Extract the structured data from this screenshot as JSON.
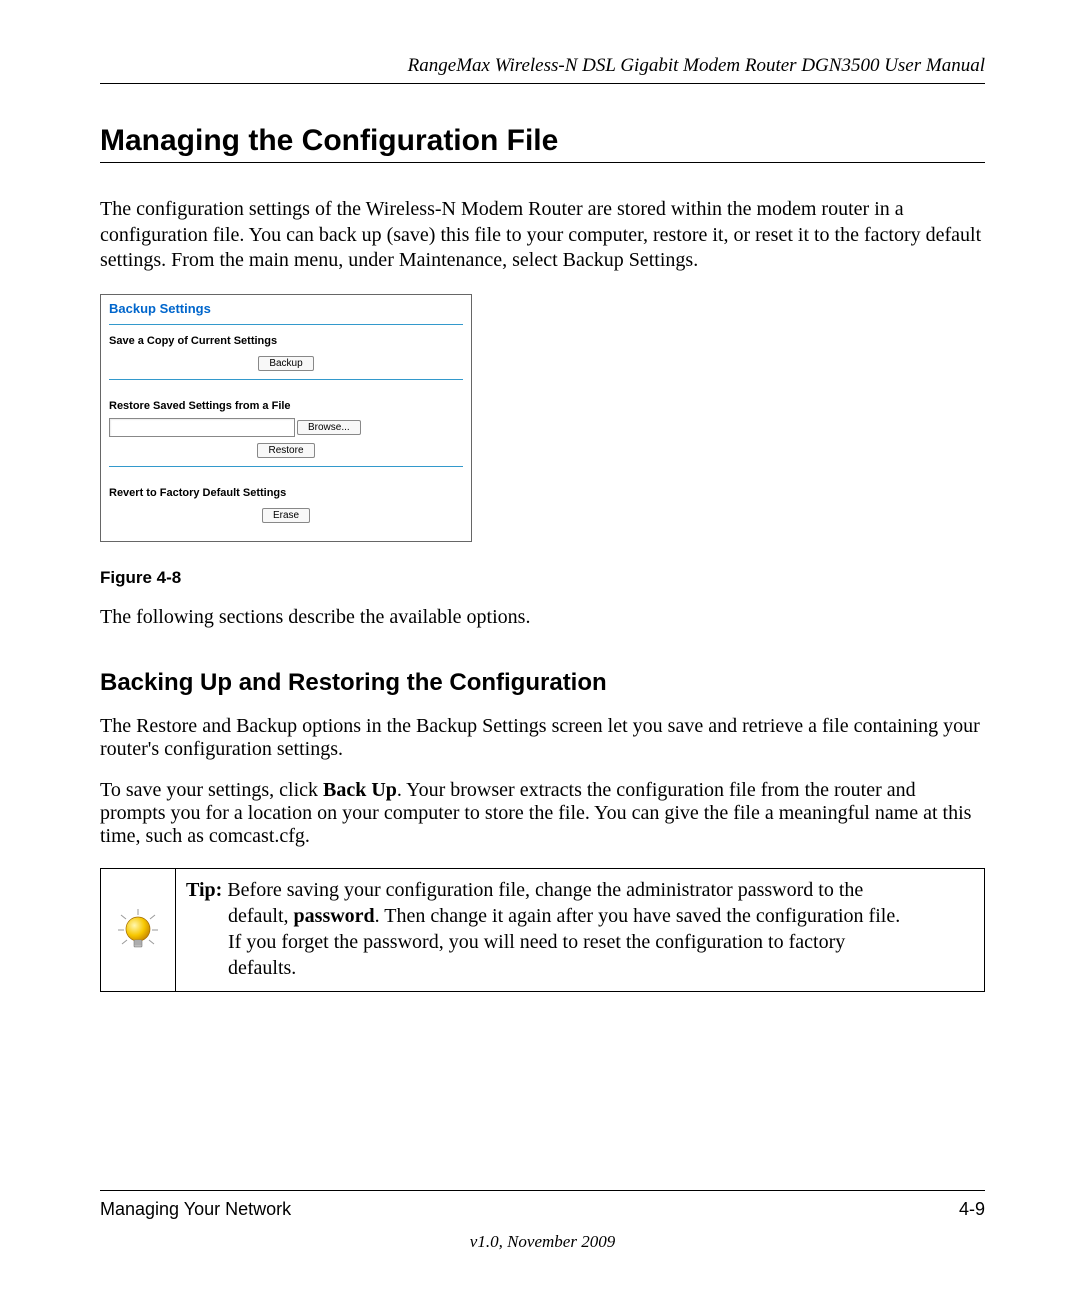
{
  "header": {
    "running_title": "RangeMax Wireless-N DSL Gigabit Modem Router DGN3500 User Manual"
  },
  "h1": "Managing the Configuration File",
  "intro_paragraph": "The configuration settings of the Wireless-N  Modem Router are stored within the modem router in a configuration file. You can back up (save) this file to your computer, restore it, or reset it to the factory default settings. From the main menu, under Maintenance, select Backup Settings.",
  "panel": {
    "title": "Backup Settings",
    "save_label": "Save a Copy of Current Settings",
    "backup_btn": "Backup",
    "restore_label": "Restore Saved Settings from a File",
    "browse_btn": "Browse...",
    "restore_btn": "Restore",
    "revert_label": "Revert to Factory Default Settings",
    "erase_btn": "Erase"
  },
  "figure_caption": "Figure 4-8",
  "after_figure_text": "The following sections describe the available options.",
  "h2": "Backing Up and Restoring the Configuration",
  "sub_p1": "The Restore and Backup options in the Backup Settings screen let you save and retrieve a file containing your router's configuration settings.",
  "sub_p2_a": "To save your settings, click ",
  "sub_p2_bold": "Back Up",
  "sub_p2_b": ". Your browser extracts the configuration file from the router and prompts you for a location on your computer to store the file. You can give the file a meaningful name at this time, such as comcast.cfg.",
  "tip": {
    "label": "Tip:",
    "line1_rest": " Before saving your configuration file, change the administrator password to the",
    "line2_a": "default, ",
    "line2_bold": "password",
    "line2_b": ". Then change it again after you have saved the configuration file.",
    "line3": "If you forget the password, you will need to reset the configuration to factory",
    "line4": "defaults."
  },
  "footer": {
    "left": "Managing Your Network",
    "right": "4-9",
    "version": "v1.0, November 2009"
  }
}
